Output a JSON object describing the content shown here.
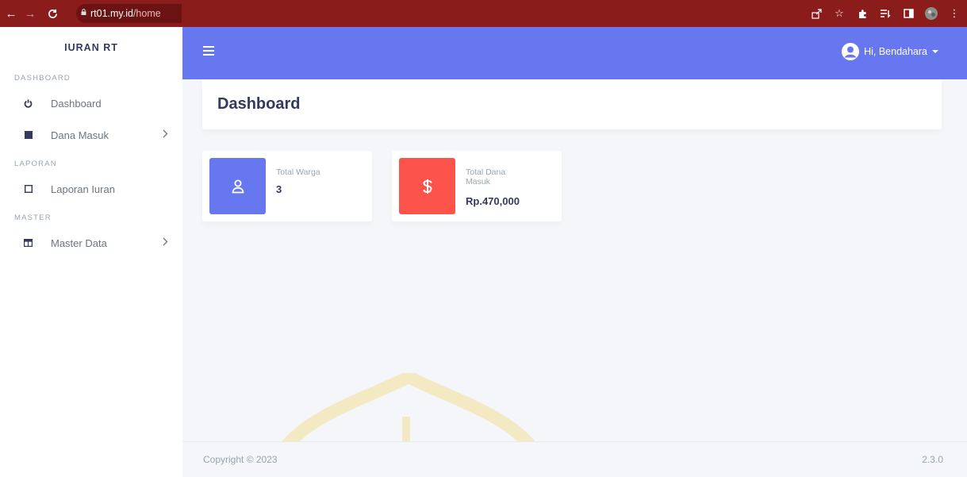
{
  "browser": {
    "url_host": "rt01.my.id",
    "url_path": "/home"
  },
  "sidebar": {
    "brand": "IURAN RT",
    "sections": [
      {
        "header": "DASHBOARD",
        "items": [
          {
            "label": "Dashboard",
            "icon": "power-icon"
          },
          {
            "label": "Dana Masuk",
            "icon": "square-icon"
          }
        ]
      },
      {
        "header": "LAPORAN",
        "items": [
          {
            "label": "Laporan Iuran",
            "icon": "square-outline-icon"
          }
        ]
      },
      {
        "header": "MASTER",
        "items": [
          {
            "label": "Master Data",
            "icon": "columns-icon"
          }
        ]
      }
    ]
  },
  "navbar": {
    "user_greeting": "Hi, Bendahara"
  },
  "page": {
    "title": "Dashboard"
  },
  "stats": [
    {
      "label": "Total Warga",
      "value": "3",
      "color": "#6777ef",
      "icon": "user-icon"
    },
    {
      "label": "Total Dana Masuk",
      "value": "Rp.470,000",
      "color": "#fc544b",
      "icon": "dollar-icon"
    }
  ],
  "footer": {
    "copyright": "Copyright © 2023",
    "version": "2.3.0"
  },
  "colors": {
    "primary": "#6777ef",
    "danger": "#fc544b",
    "chrome": "#8b1c1c",
    "background": "#f4f6f9"
  }
}
